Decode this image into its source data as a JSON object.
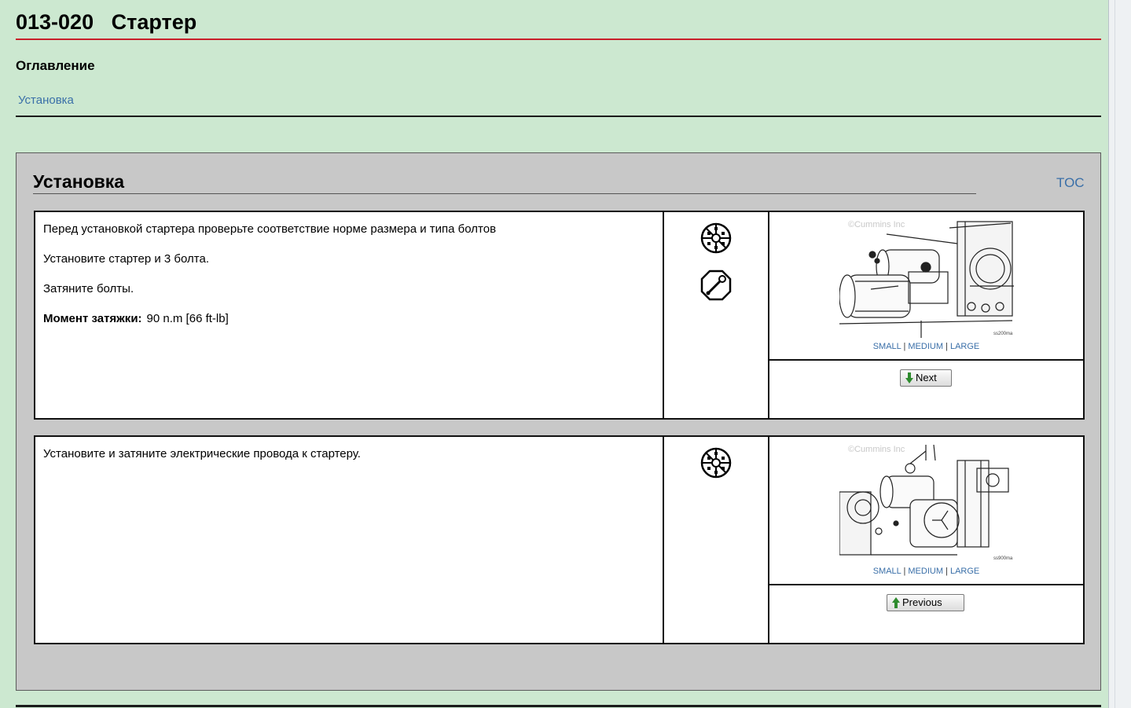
{
  "document": {
    "title": "013-020   Стартер"
  },
  "toc": {
    "heading": "Оглавление",
    "links": [
      "Установка"
    ]
  },
  "section": {
    "title": "Установка",
    "toc_link": "TOC"
  },
  "steps": [
    {
      "lines": [
        "Перед установкой стартера проверьте соответствие норме размера и типа болтов",
        "Установите стартер и 3 болта.",
        "Затяните болты."
      ],
      "torque_label": "Момент затяжки:",
      "torque_value": "90  n.m  [66 ft-lb]",
      "icons": [
        "socket-wrench-icon",
        "torque-wrench-icon"
      ],
      "figure": {
        "copyright": "©Cummins Inc",
        "figure_id": "ss200ma"
      },
      "size_links": [
        "SMALL",
        "MEDIUM",
        "LARGE"
      ],
      "nav_button": "Next",
      "nav_direction": "down"
    },
    {
      "lines": [
        "Установите и затяните электрические провода к стартеру."
      ],
      "icons": [
        "socket-wrench-icon"
      ],
      "figure": {
        "copyright": "©Cummins Inc",
        "figure_id": "ss900ma"
      },
      "size_links": [
        "SMALL",
        "MEDIUM",
        "LARGE"
      ],
      "nav_button": "Previous",
      "nav_direction": "up"
    }
  ],
  "colors": {
    "page_background": "#cce8d0",
    "section_background": "#c8c8c8",
    "title_rule": "#c8202a",
    "link": "#3a6fa8",
    "arrow_green": "#2e8b2e"
  }
}
